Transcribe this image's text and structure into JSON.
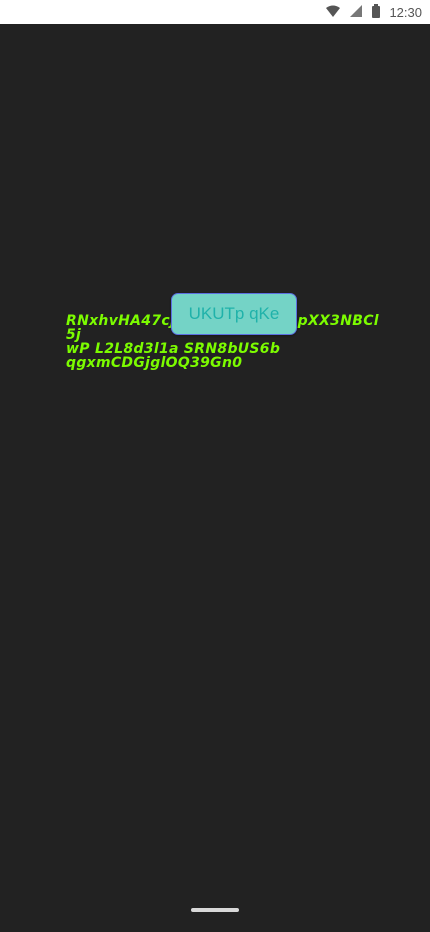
{
  "status_bar": {
    "time": "12:30",
    "icons": [
      "wifi-icon",
      "signal-icon",
      "battery-icon"
    ]
  },
  "content": {
    "lines": [
      "RNxhvHA47cj",
      "5j",
      "wP  L2L8d3l1a SRN8bUS6b",
      "qgxmCDGjglOQ39Gn0"
    ],
    "hidden_tail": "ecOpXX3NBCl",
    "button_label": "UKUTp  qKe",
    "text_color": "#7cfc00",
    "button_color": "#74d3c6",
    "background_color": "#222222"
  }
}
